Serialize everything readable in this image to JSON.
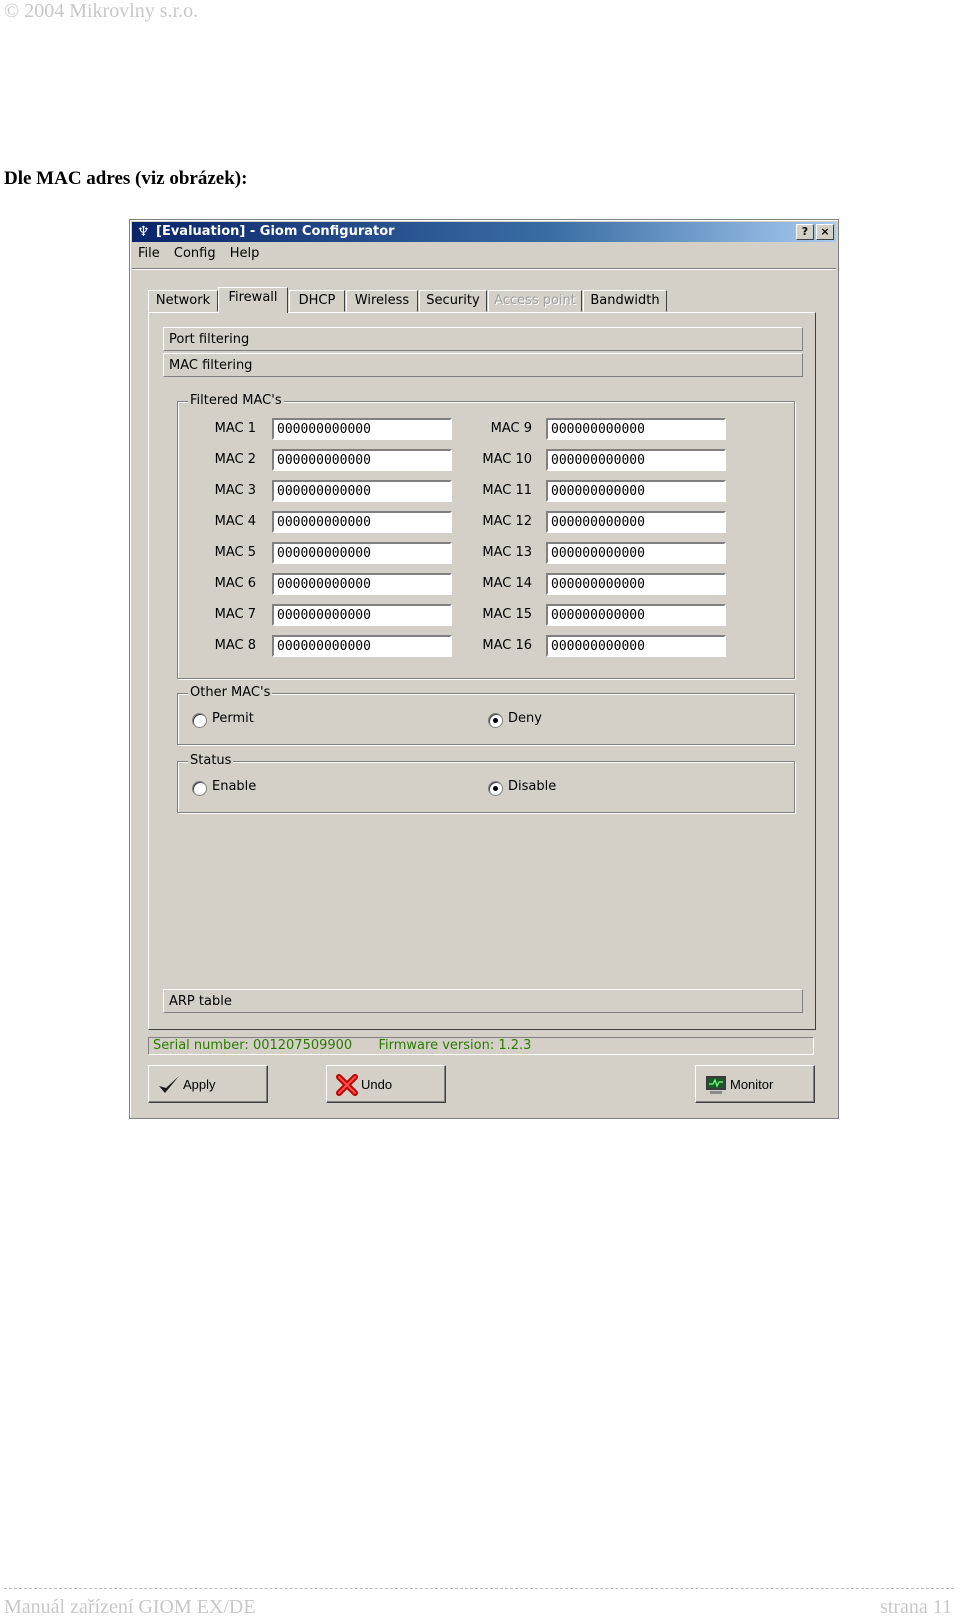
{
  "document": {
    "header": "© 2004 Mikrovlny s.r.o.",
    "heading": "Dle MAC adres (viz obrázek):",
    "footer_left": "Manuál zařízení GIOM EX/DE",
    "footer_right": "strana 11"
  },
  "window": {
    "title": "[Evaluation] - Giom Configurator",
    "help_button": "?",
    "close_button": "×"
  },
  "menu": [
    "File",
    "Config",
    "Help"
  ],
  "tabs": [
    "Network",
    "Firewall",
    "DHCP",
    "Wireless",
    "Security",
    "Access point",
    "Bandwidth"
  ],
  "active_tab": "Firewall",
  "sections": {
    "port_filtering": "Port filtering",
    "mac_filtering": "MAC filtering",
    "arp_table": "ARP table"
  },
  "filtered_macs": {
    "legend": "Filtered MAC's",
    "left": [
      {
        "label": "MAC 1",
        "value": "000000000000"
      },
      {
        "label": "MAC 2",
        "value": "000000000000"
      },
      {
        "label": "MAC 3",
        "value": "000000000000"
      },
      {
        "label": "MAC 4",
        "value": "000000000000"
      },
      {
        "label": "MAC 5",
        "value": "000000000000"
      },
      {
        "label": "MAC 6",
        "value": "000000000000"
      },
      {
        "label": "MAC 7",
        "value": "000000000000"
      },
      {
        "label": "MAC 8",
        "value": "000000000000"
      }
    ],
    "right": [
      {
        "label": "MAC 9",
        "value": "000000000000"
      },
      {
        "label": "MAC 10",
        "value": "000000000000"
      },
      {
        "label": "MAC 11",
        "value": "000000000000"
      },
      {
        "label": "MAC 12",
        "value": "000000000000"
      },
      {
        "label": "MAC 13",
        "value": "000000000000"
      },
      {
        "label": "MAC 14",
        "value": "000000000000"
      },
      {
        "label": "MAC 15",
        "value": "000000000000"
      },
      {
        "label": "MAC 16",
        "value": "000000000000"
      }
    ]
  },
  "other_macs": {
    "legend": "Other MAC's",
    "permit": "Permit",
    "deny": "Deny",
    "selected": "deny"
  },
  "status": {
    "legend": "Status",
    "enable": "Enable",
    "disable": "Disable",
    "selected": "disable"
  },
  "statusbar": {
    "serial_label": "Serial number:",
    "serial": "001207509900",
    "firmware_label": "Firmware version:",
    "firmware": "1.2.3"
  },
  "buttons": {
    "apply": "Apply",
    "undo": "Undo",
    "monitor": "Monitor"
  },
  "colors": {
    "titlebar_start": "#0a246a",
    "titlebar_end": "#a6caf0",
    "dialog_face": "#d4d0c8",
    "status_text": "#2a7a00"
  }
}
